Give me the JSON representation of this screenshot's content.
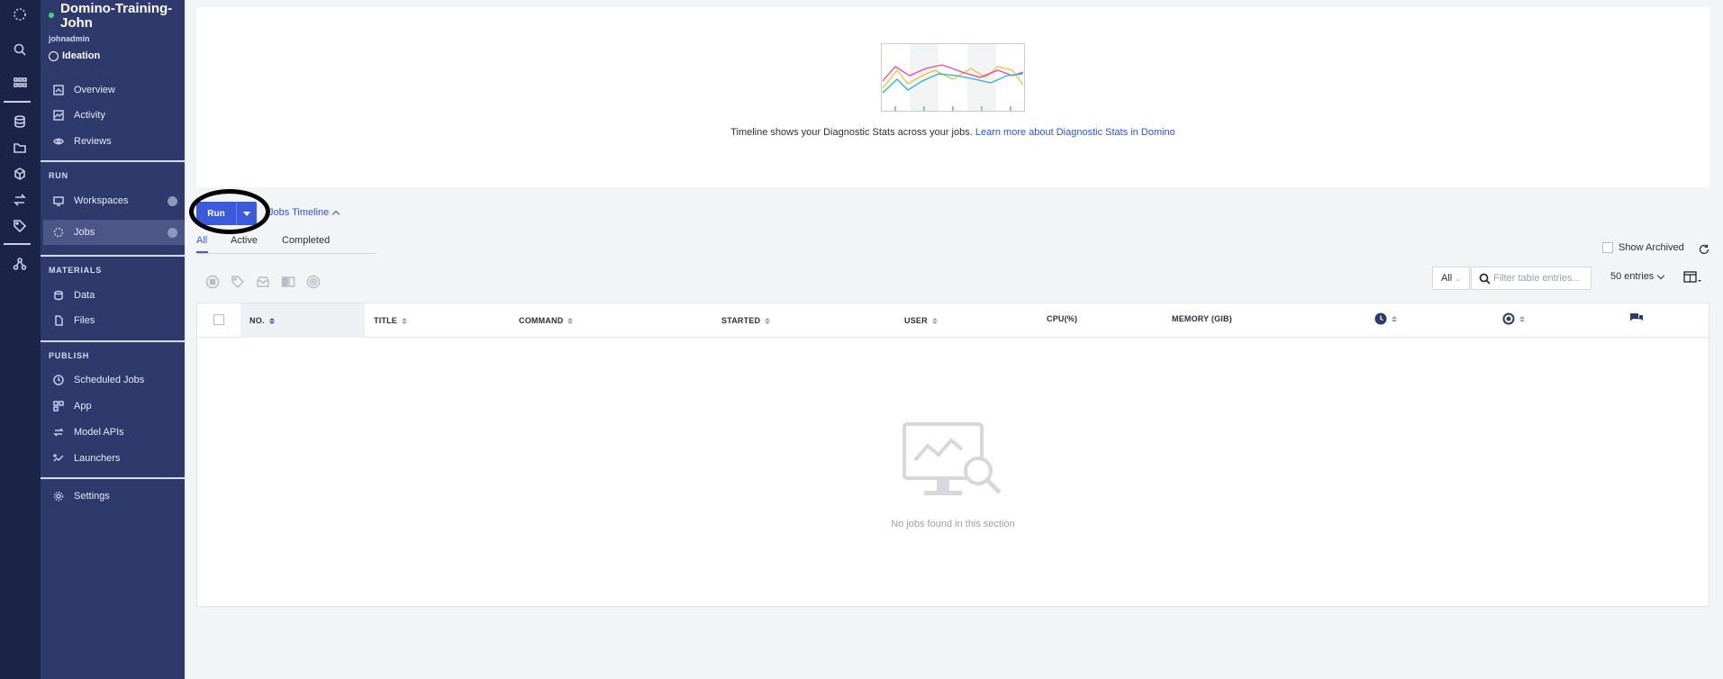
{
  "project": {
    "name": "Domino-Training-John",
    "owner": "johnadmin",
    "stage": "Ideation"
  },
  "sidebar": {
    "top_items": [
      {
        "label": "Overview"
      },
      {
        "label": "Activity"
      },
      {
        "label": "Reviews"
      }
    ],
    "run_section": "RUN",
    "run_items": [
      {
        "label": "Workspaces"
      },
      {
        "label": "Jobs"
      }
    ],
    "materials_section": "MATERIALS",
    "materials_items": [
      {
        "label": "Data"
      },
      {
        "label": "Files"
      }
    ],
    "publish_section": "PUBLISH",
    "publish_items": [
      {
        "label": "Scheduled Jobs"
      },
      {
        "label": "App"
      },
      {
        "label": "Model APIs"
      },
      {
        "label": "Launchers"
      }
    ],
    "settings_label": "Settings"
  },
  "timeline": {
    "text": "Timeline shows your Diagnostic Stats across your jobs.",
    "link": "Learn more about Diagnostic Stats in Domino"
  },
  "toolbar": {
    "run_label": "Run",
    "jobs_timeline_label": "Jobs Timeline",
    "show_archived_label": "Show Archived",
    "status_filter": "All",
    "filter_placeholder": "Filter table entries...",
    "entries_label": "50 entries"
  },
  "tabs": [
    {
      "label": "All",
      "active": true
    },
    {
      "label": "Active",
      "active": false
    },
    {
      "label": "Completed",
      "active": false
    }
  ],
  "table": {
    "columns": [
      "NO.",
      "TITLE",
      "COMMAND",
      "STARTED",
      "USER",
      "CPU(%)",
      "MEMORY (GIB)"
    ],
    "empty_text": "No jobs found in this section"
  },
  "colors": {
    "accent": "#3b5bdb",
    "sidebar_bg": "#2d3a6b",
    "rail_bg": "#1b2346",
    "status_dot": "#49d17d"
  }
}
